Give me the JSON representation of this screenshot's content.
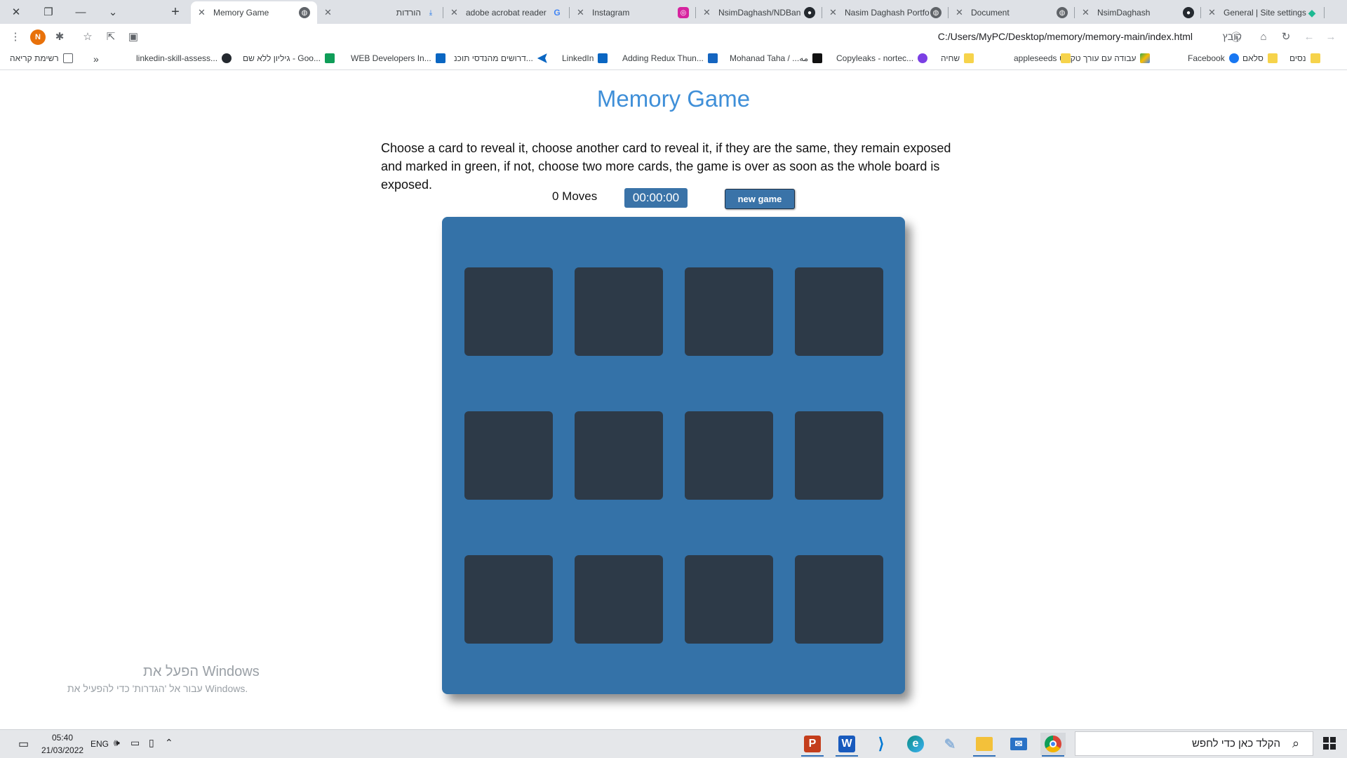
{
  "browser": {
    "tabs": [
      {
        "title": "Memory Game",
        "icon": "globe-icon",
        "active": true
      },
      {
        "title": "הורדות",
        "icon": "download-icon"
      },
      {
        "title": "adobe acrobat reader",
        "icon": "google-icon"
      },
      {
        "title": "Instagram",
        "icon": "instagram-icon"
      },
      {
        "title": "NsimDaghash/NDBan",
        "icon": "github-icon"
      },
      {
        "title": "Nasim Daghash Portfo",
        "icon": "globe-icon"
      },
      {
        "title": "Document",
        "icon": "globe-icon"
      },
      {
        "title": "NsimDaghash",
        "icon": "github-icon"
      },
      {
        "title": "General | Site settings",
        "icon": "diamond-icon"
      }
    ],
    "address": {
      "url": "C:/Users/MyPC/Desktop/memory/memory-main/index.html",
      "scheme_label": "קובץ"
    },
    "profile_initial": "N",
    "bookmarks": [
      {
        "label": "נסים",
        "color": "#f6d34b"
      },
      {
        "label": "סלאם",
        "color": "#f6d34b"
      },
      {
        "label": "Facebook",
        "color": "#1877f2"
      },
      {
        "label": "עבודה עם עורך טקסט",
        "color": "#34a853"
      },
      {
        "label": "appleseeds",
        "color": "#f6d34b"
      },
      {
        "label": "שחיה",
        "color": "#f6d34b"
      },
      {
        "label": "Copyleaks - nortec...",
        "color": "#7b3fe4"
      },
      {
        "label": "Mohanad Taha / ...مه",
        "color": "#111111"
      },
      {
        "label": "Adding Redux Thun...",
        "color": "#1565c0"
      },
      {
        "label": "LinkedIn",
        "color": "#0a66c2"
      },
      {
        "label": "דרושים מהנדסי תוכנ...",
        "color": "#0a66c2"
      },
      {
        "label": "WEB Developers In...",
        "color": "#0a66c2"
      },
      {
        "label": "גיליון ללא שם - Goo...",
        "color": "#0f9d58"
      },
      {
        "label": "linkedin-skill-assess...",
        "color": "#24292f"
      }
    ],
    "reading_list_label": "רשימת קריאה",
    "more_bookmarks": "»"
  },
  "game": {
    "title": "Memory Game",
    "description": "Choose a card to reveal it, choose another card to reveal it, if they are the same, they remain exposed and marked in green, if not, choose two more cards, the game is over as soon as the whole board is exposed.",
    "moves": "0 Moves",
    "timer": "00:00:00",
    "new_game_label": "new game",
    "colors": {
      "title": "#3f8fd8",
      "board": "#3472a8",
      "card_back": "#2d3a48",
      "button": "#3a73a8"
    },
    "cards": [
      {
        "id": 1
      },
      {
        "id": 2
      },
      {
        "id": 3
      },
      {
        "id": 4
      },
      {
        "id": 5
      },
      {
        "id": 6
      },
      {
        "id": 7
      },
      {
        "id": 8
      },
      {
        "id": 9
      },
      {
        "id": 10
      },
      {
        "id": 11
      },
      {
        "id": 12
      }
    ]
  },
  "watermark": {
    "line1": "הפעל את Windows",
    "line2": "עבור אל 'הגדרות' כדי להפעיל את Windows."
  },
  "taskbar": {
    "time": "05:40",
    "date": "21/03/2022",
    "language": "ENG",
    "search_placeholder": "הקלד כאן כדי לחפש",
    "apps": [
      {
        "name": "powerpoint-icon",
        "color": "#c43e1c",
        "glyph": "P"
      },
      {
        "name": "word-icon",
        "color": "#185abd",
        "glyph": "W"
      },
      {
        "name": "vscode-icon",
        "color": "#0078d4",
        "glyph": "⟩"
      },
      {
        "name": "edge-icon",
        "color": "#0c8f87",
        "glyph": "e"
      },
      {
        "name": "paint-icon",
        "color": "#8fb3d9",
        "glyph": "✎"
      },
      {
        "name": "file-explorer-icon",
        "color": "#f3c13a",
        "glyph": "▤"
      },
      {
        "name": "mail-icon",
        "color": "#2a72c6",
        "glyph": "✉"
      },
      {
        "name": "chrome-icon",
        "color": "#db4437",
        "glyph": "◉"
      }
    ]
  }
}
